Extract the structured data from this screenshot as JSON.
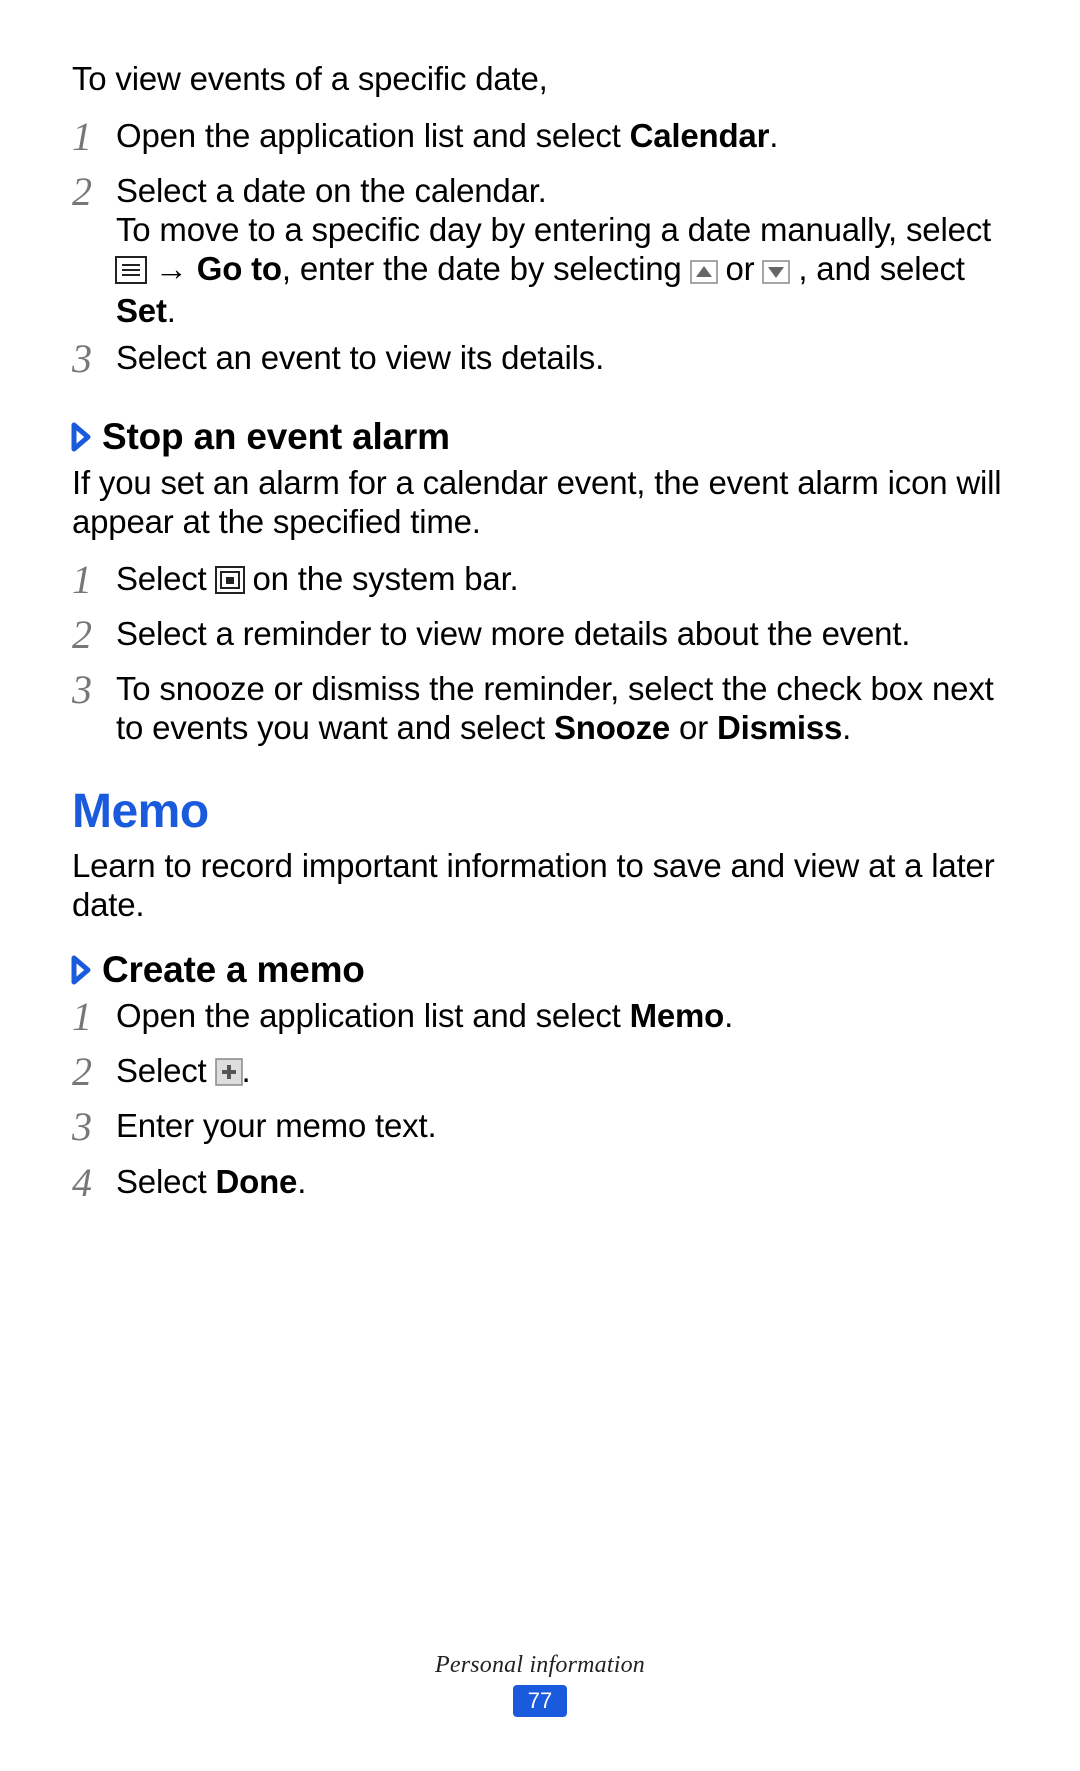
{
  "intro": "To view events of a specific date,",
  "list1": {
    "n1": "1",
    "i1a": "Open the application list and select ",
    "i1b": "Calendar",
    "i1c": ".",
    "n2": "2",
    "i2a": "Select a date on the calendar.",
    "i2b": "To move to a specific day by entering a date manually, select ",
    "i2c": " → ",
    "i2d": "Go to",
    "i2e": ", enter the date by selecting ",
    "i2f": " or ",
    "i2g": " , and select ",
    "i2h": "Set",
    "i2i": ".",
    "n3": "3",
    "i3": "Select an event to view its details."
  },
  "sub1": "Stop an event alarm",
  "sub1text": "If you set an alarm for a calendar event, the event alarm icon will appear at the specified time.",
  "list2": {
    "n1": "1",
    "i1a": "Select ",
    "i1b": " on the system bar.",
    "n2": "2",
    "i2": "Select a reminder to view more details about the event.",
    "n3": "3",
    "i3a": "To snooze or dismiss the reminder, select the check box next to events you want and select ",
    "i3b": "Snooze",
    "i3c": " or ",
    "i3d": "Dismiss",
    "i3e": "."
  },
  "section": "Memo",
  "sectiontext": "Learn to record important information to save and view at a later date.",
  "sub2": "Create a memo",
  "list3": {
    "n1": "1",
    "i1a": "Open the application list and select ",
    "i1b": "Memo",
    "i1c": ".",
    "n2": "2",
    "i2a": "Select ",
    "i2b": ".",
    "n3": "3",
    "i3": "Enter your memo text.",
    "n4": "4",
    "i4a": "Select ",
    "i4b": "Done",
    "i4c": "."
  },
  "footer": {
    "label": "Personal information",
    "page": "77"
  }
}
